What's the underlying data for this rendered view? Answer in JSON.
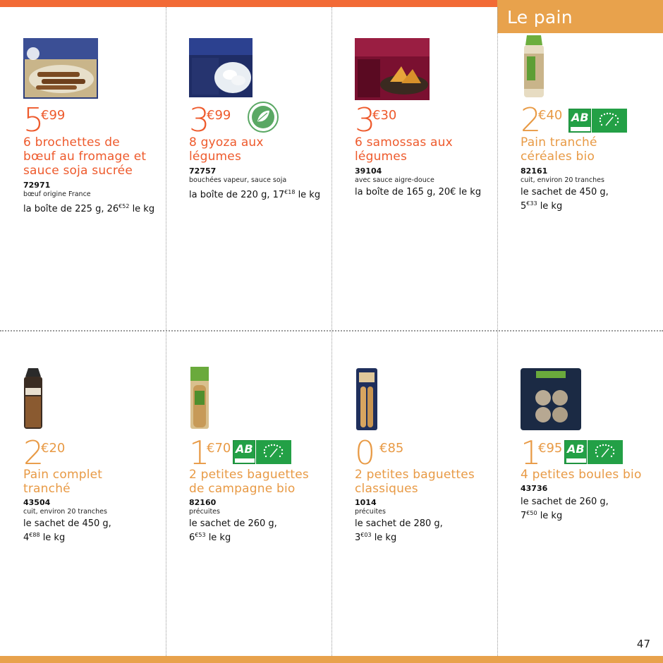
{
  "section": {
    "title": "Le pain"
  },
  "page": {
    "number": "47"
  },
  "colors": {
    "accent_red": "#f26a36",
    "accent_orange": "#e8a24c",
    "bio_green": "#23a046"
  },
  "products": [
    {
      "price_euros": "5",
      "price_cents": "€99",
      "title_line1": "6 brochettes de",
      "title_line2": "bœuf au fromage et",
      "title_line3": "sauce soja sucrée",
      "code": "72971",
      "desc": "bœuf origine France",
      "unit_a": "la boîte de 225 g, 26",
      "unit_sup": "€52",
      "unit_b": " le kg",
      "image": "boxed-beef-skewers",
      "badge": "none"
    },
    {
      "price_euros": "3",
      "price_cents": "€99",
      "title_line1": "8 gyoza aux",
      "title_line2": "légumes",
      "code": "72757",
      "desc": "bouchées vapeur, sauce soja",
      "unit_a": "la boîte de 220 g, 17",
      "unit_sup": "€18",
      "unit_b": " le kg",
      "image": "boxed-gyoza",
      "badge": "vegetarian-leaf"
    },
    {
      "price_euros": "3",
      "price_cents": "€30",
      "title_line1": "6 samossas aux",
      "title_line2": "légumes",
      "code": "39104",
      "desc": "avec sauce aigre-douce",
      "unit_a": "la boîte de 165 g, 20€ le kg",
      "image": "boxed-samosas",
      "badge": "none"
    },
    {
      "price_euros": "2",
      "price_cents": "€40",
      "title_line1": "Pain tranché",
      "title_line2": "céréales bio",
      "code": "82161",
      "desc": "cuit, environ 20 tranches",
      "unit_a": "le sachet de 450 g,",
      "unit_c": "5",
      "unit_sup": "€33",
      "unit_b": " le kg",
      "image": "sliced-cereal-bread-bag",
      "badge": "ab-eu-organic"
    },
    {
      "price_euros": "2",
      "price_cents": "€20",
      "title_line1": "Pain complet",
      "title_line2": "tranché",
      "code": "43504",
      "desc": "cuit, environ 20 tranches",
      "unit_a": "le sachet de 450 g,",
      "unit_c": "4",
      "unit_sup": "€88",
      "unit_b": " le kg",
      "image": "sliced-wholemeal-bread-bag",
      "badge": "none"
    },
    {
      "price_euros": "1",
      "price_cents": "€70",
      "title_line1": "2 petites baguettes",
      "title_line2": "de campagne bio",
      "code": "82160",
      "desc": "précuites",
      "unit_a": "le sachet de 260 g,",
      "unit_c": "6",
      "unit_sup": "€53",
      "unit_b": " le kg",
      "image": "country-baguettes-bag",
      "badge": "ab-eu-organic"
    },
    {
      "price_euros": "0",
      "price_cents": "€85",
      "title_line1": "2 petites baguettes",
      "title_line2": "classiques",
      "code": "1014",
      "desc": "précuites",
      "unit_a": "le sachet de 280 g,",
      "unit_c": "3",
      "unit_sup": "€03",
      "unit_b": " le kg",
      "image": "classic-baguettes-bag",
      "badge": "none"
    },
    {
      "price_euros": "1",
      "price_cents": "€95",
      "title_line1": "4 petites boules bio",
      "code": "43736",
      "unit_a": "le sachet de 260 g,",
      "unit_c": "7",
      "unit_sup": "€50",
      "unit_b": " le kg",
      "image": "organic-rolls-pack",
      "badge": "ab-eu-organic"
    }
  ]
}
